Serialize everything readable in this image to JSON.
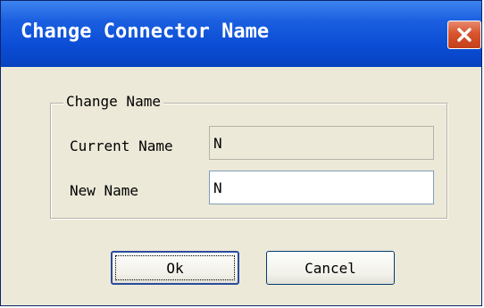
{
  "window": {
    "title": "Change Connector Name",
    "close_icon": "close-icon"
  },
  "group": {
    "legend": "Change Name",
    "current_name_label": "Current Name",
    "current_name_value": "N",
    "new_name_label": "New Name",
    "new_name_value": "N"
  },
  "buttons": {
    "ok_label": "Ok",
    "cancel_label": "Cancel"
  },
  "colors": {
    "titlebar": "#0a4cd4",
    "close_button": "#d9542d",
    "dialog_face": "#ece9d8"
  }
}
